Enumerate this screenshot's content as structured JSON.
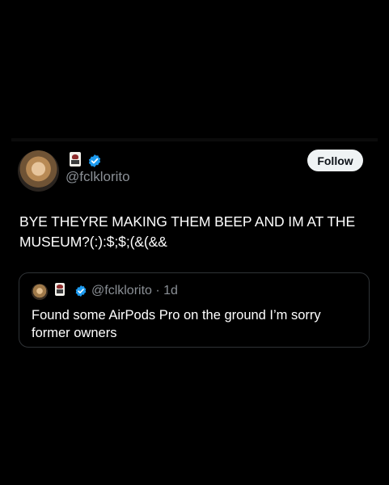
{
  "tweet": {
    "author_handle": "@fclklorito",
    "follow_label": "Follow",
    "text": "BYE THEYRE MAKING THEM BEEP AND IM AT THE MUSEUM?(:):$;$;(&(&&"
  },
  "quote": {
    "author_handle": "@fclklorito",
    "separator": " · ",
    "time": "1d",
    "text": "Found some AirPods Pro on the ground I’m sorry former owners"
  },
  "colors": {
    "background": "#000000",
    "verified": "#1d9bf0",
    "muted_text": "#8b9096",
    "follow_bg": "#eff3f4"
  },
  "icons": {
    "verified": "verified-badge-icon",
    "emoji": "playing-card-emoji-icon"
  }
}
